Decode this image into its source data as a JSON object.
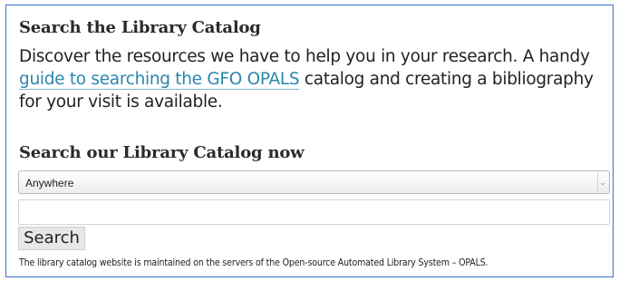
{
  "catalog": {
    "heading": "Search the Library Catalog",
    "intro_prefix": "Discover the resources we have to help you in your research. A handy",
    "guide_link": "guide to searching the GFO OPALS",
    "intro_suffix": "catalog and creating a bibliography for your visit is available.",
    "subheading": "Search our Library Catalog now",
    "scope_select": {
      "selected": "Anywhere"
    },
    "search_input": {
      "value": "",
      "placeholder": ""
    },
    "search_button": "Search",
    "footnote": "The library catalog website is maintained on the servers of the Open-source Automated Library System – OPALS."
  },
  "colors": {
    "border": "#3d6fd0",
    "link": "#2b86ad",
    "text": "#222222"
  },
  "icons": {
    "select_arrow": "chevron-down-icon"
  }
}
